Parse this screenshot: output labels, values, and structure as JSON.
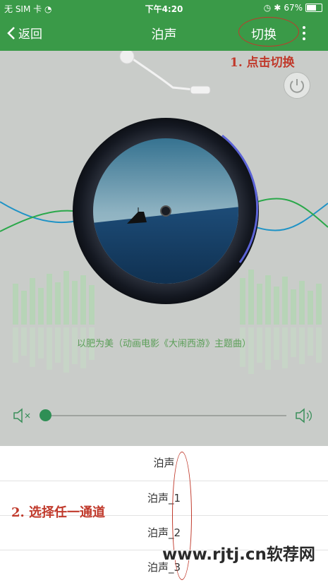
{
  "status_bar": {
    "carrier": "无 SIM 卡",
    "time": "下午4:20",
    "battery": "67%",
    "battery_level": 0.67
  },
  "nav": {
    "back_label": "返回",
    "title": "泊声",
    "switch_label": "切换"
  },
  "annotations": {
    "step1": "1. 点击切换",
    "step2": "2. 选择任一通道"
  },
  "player": {
    "song_title": "以肥为美（动画电影《大闹西游》主题曲）",
    "volume_level": 0.0,
    "accent_color": "#2f8f55"
  },
  "channels": [
    "泊声",
    "泊声_1",
    "泊声_2",
    "泊声_3"
  ],
  "watermark": "www.rjtj.cn软荐网",
  "colors": {
    "nav_bg": "#3a9a48",
    "annotation": "#c0392b"
  }
}
